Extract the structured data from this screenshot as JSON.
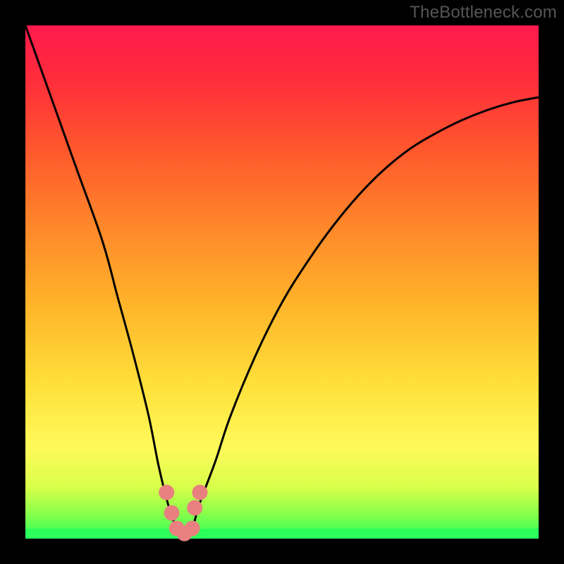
{
  "watermark": "TheBottleneck.com",
  "colors": {
    "black": "#000000",
    "gradient_stops": [
      {
        "offset": 0.0,
        "color": "#ff1a4d"
      },
      {
        "offset": 0.1,
        "color": "#ff2b3c"
      },
      {
        "offset": 0.25,
        "color": "#ff5a2c"
      },
      {
        "offset": 0.4,
        "color": "#ff8a2a"
      },
      {
        "offset": 0.55,
        "color": "#ffb62a"
      },
      {
        "offset": 0.7,
        "color": "#ffe03a"
      },
      {
        "offset": 0.82,
        "color": "#fff95a"
      },
      {
        "offset": 0.9,
        "color": "#d9ff4a"
      },
      {
        "offset": 0.95,
        "color": "#8aff4a"
      },
      {
        "offset": 1.0,
        "color": "#2bff5a"
      }
    ],
    "curve": "#000000",
    "marker_fill": "#e98080",
    "marker_stroke": "#c44848",
    "green_band": "#2bff5a"
  },
  "chart_data": {
    "type": "line",
    "title": "",
    "xlabel": "",
    "ylabel": "",
    "xlim": [
      0,
      100
    ],
    "ylim": [
      0,
      100
    ],
    "grid": false,
    "legend": false,
    "annotations": [
      "TheBottleneck.com"
    ],
    "series": [
      {
        "name": "bottleneck-curve",
        "x": [
          0,
          5,
          10,
          15,
          18,
          21,
          24,
          26,
          28,
          29.5,
          31,
          32.5,
          34,
          37,
          40,
          45,
          50,
          55,
          60,
          65,
          70,
          75,
          80,
          85,
          90,
          95,
          100
        ],
        "y": [
          100,
          86,
          72,
          58,
          47,
          36,
          24,
          14,
          6,
          2,
          0,
          2,
          7,
          15,
          24,
          36,
          46,
          54,
          61,
          67,
          72,
          76,
          79,
          81.5,
          83.5,
          85,
          86
        ]
      }
    ],
    "markers": [
      {
        "x": 27.5,
        "y": 9
      },
      {
        "x": 28.5,
        "y": 5
      },
      {
        "x": 29.5,
        "y": 2
      },
      {
        "x": 31.0,
        "y": 1
      },
      {
        "x": 32.5,
        "y": 2
      },
      {
        "x": 33.0,
        "y": 6
      },
      {
        "x": 34.0,
        "y": 9
      }
    ],
    "background_gradient_axis": "y",
    "green_zone_y": [
      0,
      2
    ]
  }
}
